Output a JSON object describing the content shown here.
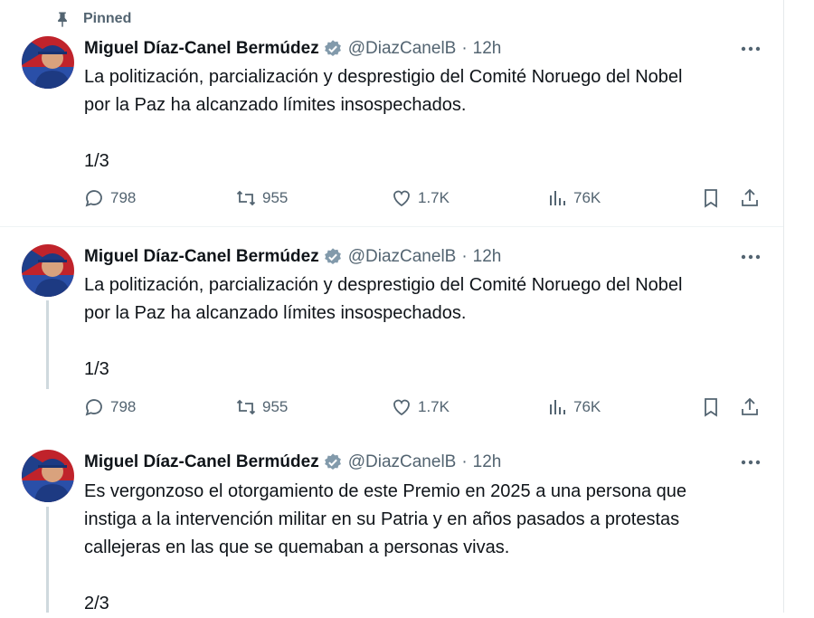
{
  "pinned_label": "Pinned",
  "tweets": [
    {
      "name": "Miguel Díaz-Canel Bermúdez",
      "handle": "@DiazCanelB",
      "separator": "·",
      "time": "12h",
      "lines": [
        "La politización,  parcialización y desprestigio del Comité Noruego del Nobel",
        "por la Paz ha alcanzado límites insospechados."
      ],
      "counter": "1/3",
      "replies": "798",
      "reposts": "955",
      "likes": "1.7K",
      "views": "76K"
    },
    {
      "name": "Miguel Díaz-Canel Bermúdez",
      "handle": "@DiazCanelB",
      "separator": "·",
      "time": "12h",
      "lines": [
        "La politización,  parcialización y desprestigio del Comité Noruego del Nobel",
        "por la Paz ha alcanzado límites insospechados."
      ],
      "counter": "1/3",
      "replies": "798",
      "reposts": "955",
      "likes": "1.7K",
      "views": "76K"
    },
    {
      "name": "Miguel Díaz-Canel Bermúdez",
      "handle": "@DiazCanelB",
      "separator": "·",
      "time": "12h",
      "lines": [
        "Es vergonzoso el otorgamiento de este Premio en 2025 a una persona que",
        "instiga a la intervención militar en su Patria y en años pasados a protestas",
        "callejeras en las que se quemaban a personas vivas."
      ],
      "counter": "2/3"
    }
  ],
  "colors": {
    "text_primary": "#0f1419",
    "text_secondary": "#536471",
    "verified": "#829aab",
    "divider": "#eff3f4"
  }
}
